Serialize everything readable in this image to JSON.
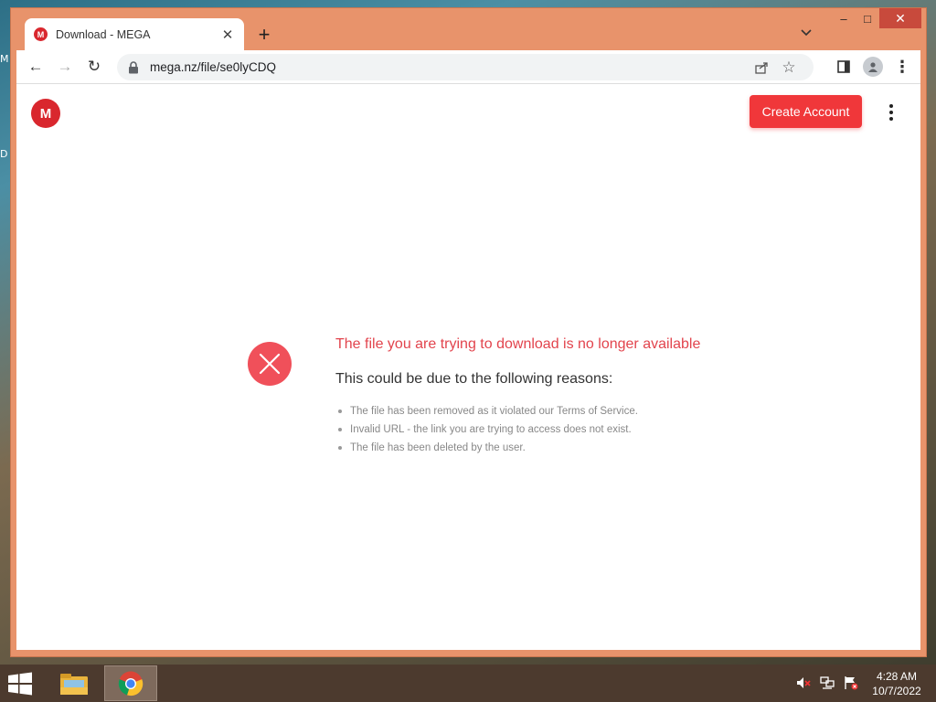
{
  "desktop": {
    "labels": [
      "M",
      "D"
    ]
  },
  "window": {
    "controls": {
      "minimize": "–",
      "maximize": "□",
      "close": "✕"
    }
  },
  "tab": {
    "title": "Download - MEGA",
    "favicon_letter": "M",
    "close": "✕",
    "new_tab": "+",
    "dropdown": "⌄"
  },
  "toolbar": {
    "url": "mega.nz/file/se0lyCDQ",
    "back": "←",
    "forward": "→",
    "reload": "↻",
    "share_icon": "share-icon",
    "bookmark": "☆",
    "menu": "⋮"
  },
  "page": {
    "logo_letter": "M",
    "create_account": "Create Account",
    "error_title": "The file you are trying to download is no longer available",
    "error_subtitle": "This could be due to the following reasons:",
    "reasons": [
      "The file has been removed as it violated our Terms of Service.",
      "Invalid URL - the link you are trying to access does not exist.",
      "The file has been deleted by the user."
    ],
    "colors": {
      "brand": "#d9272e",
      "button": "#f0373a",
      "error_text": "#e2444d"
    }
  },
  "taskbar": {
    "time": "4:28 AM",
    "date": "10/7/2022",
    "apps": [
      "file-explorer-icon",
      "chrome-icon"
    ]
  }
}
